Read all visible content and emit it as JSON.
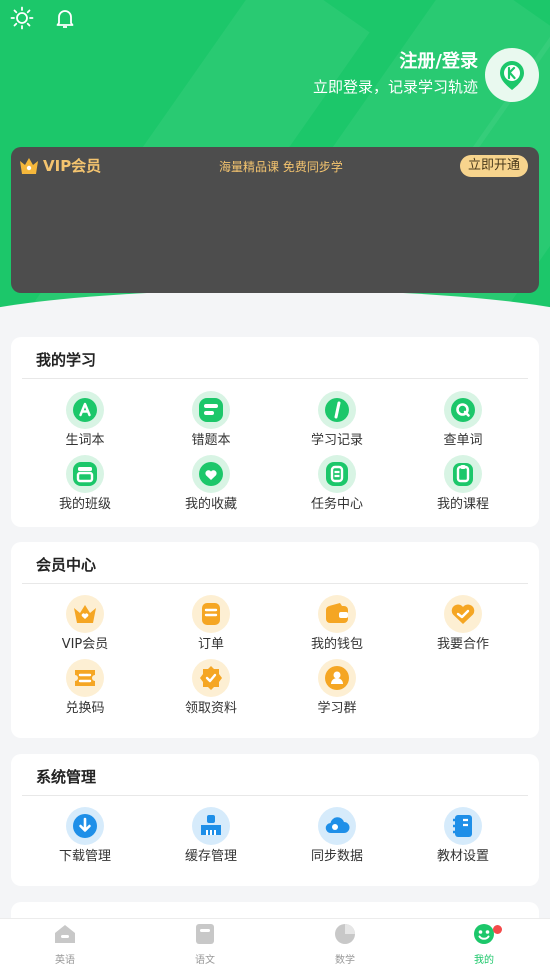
{
  "header": {
    "login_title": "注册/登录",
    "login_subtitle": "立即登录，记录学习轨迹",
    "accent": "#1cc76a"
  },
  "vip": {
    "title": "VIP会员",
    "slogan": "海量精品课 免费同步学",
    "button": "立即开通"
  },
  "sections": {
    "study": {
      "title": "我的学习",
      "items": [
        "生词本",
        "错题本",
        "学习记录",
        "查单词",
        "我的班级",
        "我的收藏",
        "任务中心",
        "我的课程"
      ]
    },
    "member": {
      "title": "会员中心",
      "items": [
        "VIP会员",
        "订单",
        "我的钱包",
        "我要合作",
        "兑换码",
        "领取资料",
        "学习群"
      ]
    },
    "system": {
      "title": "系统管理",
      "items": [
        "下载管理",
        "缓存管理",
        "同步数据",
        "教材设置"
      ]
    }
  },
  "tabs": [
    "英语",
    "语文",
    "数学",
    "我的"
  ],
  "active_tab": "我的"
}
